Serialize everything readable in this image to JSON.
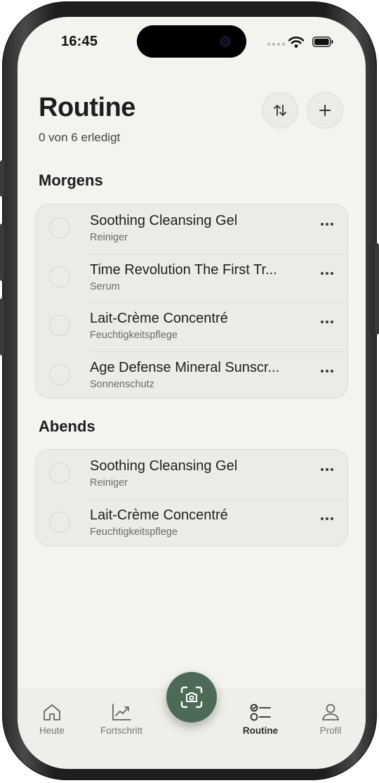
{
  "status_bar": {
    "time": "16:45"
  },
  "header": {
    "title": "Routine",
    "progress_text": "0 von 6 erledigt",
    "sort_icon": "sort-arrows-icon",
    "add_icon": "plus-icon"
  },
  "sections": [
    {
      "title": "Morgens",
      "items": [
        {
          "name": "Soothing Cleansing Gel",
          "category": "Reiniger",
          "done": false
        },
        {
          "name": "Time Revolution The First Tr...",
          "category": "Serum",
          "done": false
        },
        {
          "name": "Lait-Crème Concentré",
          "category": "Feuchtigkeitspflege",
          "done": false
        },
        {
          "name": "Age Defense Mineral Sunscr...",
          "category": "Sonnenschutz",
          "done": false
        }
      ]
    },
    {
      "title": "Abends",
      "items": [
        {
          "name": "Soothing Cleansing Gel",
          "category": "Reiniger",
          "done": false
        },
        {
          "name": "Lait-Crème Concentré",
          "category": "Feuchtigkeitspflege",
          "done": false
        }
      ]
    }
  ],
  "tabbar": {
    "tabs": [
      {
        "label": "Heute",
        "icon": "house-icon",
        "active": false
      },
      {
        "label": "Fortschritt",
        "icon": "chart-icon",
        "active": false
      },
      {
        "label": "Routine",
        "icon": "checklist-icon",
        "active": true
      },
      {
        "label": "Profil",
        "icon": "person-icon",
        "active": false
      }
    ],
    "center_button_icon": "camera-scan-icon"
  },
  "colors": {
    "accent": "#4d6a57",
    "background": "#f4f3f0",
    "card": "#ecebe7"
  }
}
